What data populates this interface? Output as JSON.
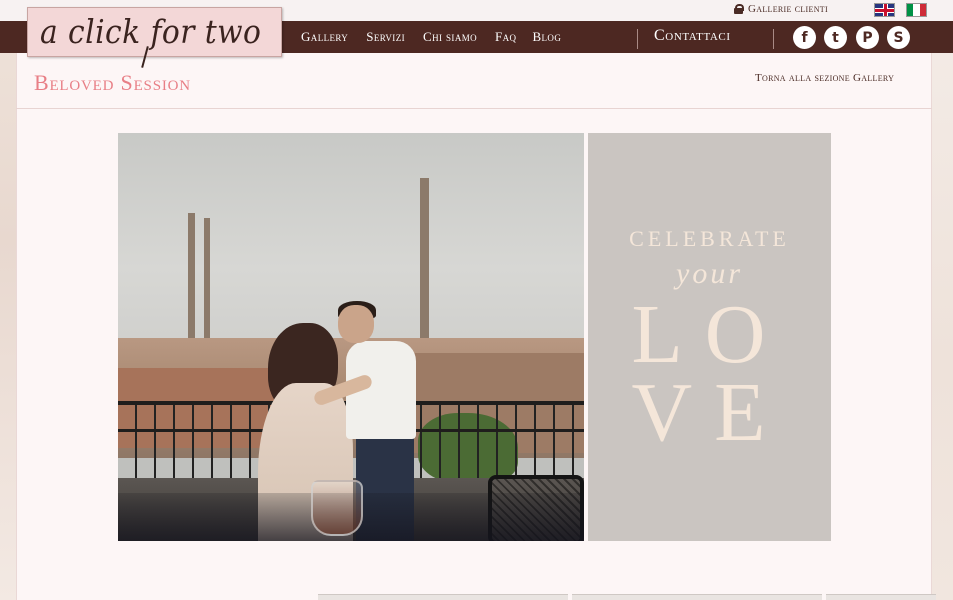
{
  "logo": {
    "text": "a click for two"
  },
  "topbar": {
    "client_galleries": "Gallerie clienti"
  },
  "nav": {
    "items": [
      {
        "label": "Gallery"
      },
      {
        "label": "Servizi"
      },
      {
        "label": "Chi siamo"
      },
      {
        "label": "Faq"
      },
      {
        "label": "Blog"
      }
    ],
    "contact": "Contattaci"
  },
  "social": {
    "icons": [
      {
        "name": "facebook-icon",
        "glyph": "f"
      },
      {
        "name": "twitter-icon",
        "glyph": "t"
      },
      {
        "name": "pinterest-icon",
        "glyph": "P"
      },
      {
        "name": "skype-icon",
        "glyph": "S"
      }
    ]
  },
  "page": {
    "title": "Beloved Session",
    "back_link": "Torna alla sezione Gallery"
  },
  "card": {
    "line1": "CELEBRATE",
    "line2": "your",
    "line3": "LO",
    "line4": "VE"
  },
  "colors": {
    "nav_bg": "#4d2822",
    "title": "#e87f86",
    "logo_bg": "#f3d7d7",
    "card_bg": "#cac5c1",
    "card_text": "#f4e6d9"
  }
}
